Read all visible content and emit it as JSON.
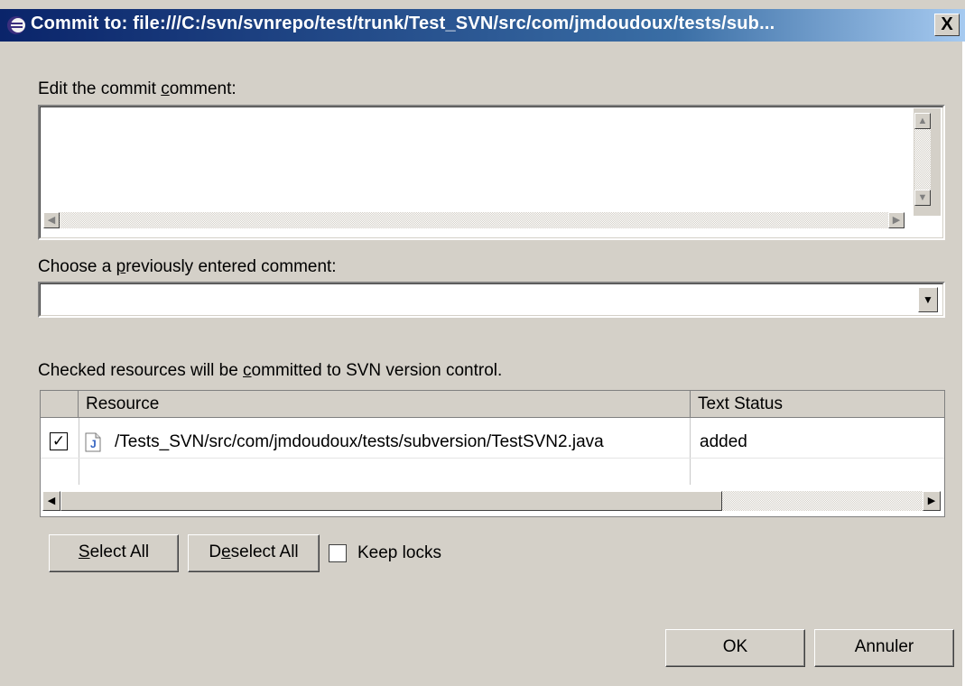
{
  "window": {
    "title": "Commit to: file:///C:/svn/svnrepo/test/trunk/Test_SVN/src/com/jmdoudoux/tests/sub...",
    "close_label": "X"
  },
  "comment": {
    "label_pre": "Edit the commit ",
    "label_key": "c",
    "label_post": "omment:",
    "value": ""
  },
  "previous": {
    "label_pre": "Choose a ",
    "label_key": "p",
    "label_post": "reviously entered comment:",
    "value": ""
  },
  "resources": {
    "label_pre": "Checked resources will be ",
    "label_key": "c",
    "label_post": "ommitted to SVN version control.",
    "columns": [
      "Resource",
      "Text Status"
    ],
    "rows": [
      {
        "checked": true,
        "icon": "java-file-icon",
        "resource": "/Tests_SVN/src/com/jmdoudoux/tests/subversion/TestSVN2.java",
        "status": "added"
      }
    ]
  },
  "buttons": {
    "select_all_key": "S",
    "select_all_rest": "elect All",
    "deselect_pre": "D",
    "deselect_key": "e",
    "deselect_rest": "select All",
    "keep_locks": "Keep locks",
    "ok": "OK",
    "cancel": "Annuler"
  }
}
